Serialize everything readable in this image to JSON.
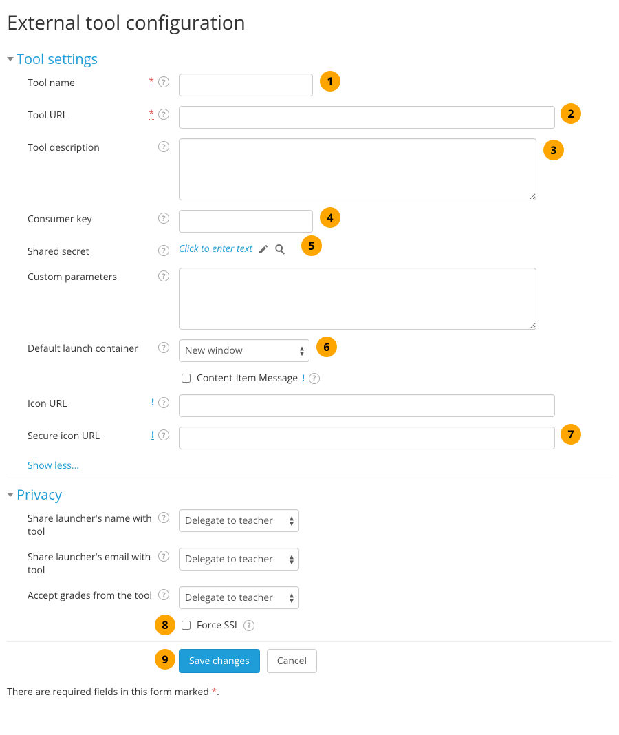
{
  "page_title": "External tool configuration",
  "sections": {
    "tool_settings": {
      "title": "Tool settings",
      "fields": {
        "tool_name": {
          "label": "Tool name",
          "value": ""
        },
        "tool_url": {
          "label": "Tool URL",
          "value": ""
        },
        "tool_description": {
          "label": "Tool description",
          "value": ""
        },
        "consumer_key": {
          "label": "Consumer key",
          "value": ""
        },
        "shared_secret": {
          "label": "Shared secret",
          "placeholder_link": "Click to enter text"
        },
        "custom_parameters": {
          "label": "Custom parameters",
          "value": ""
        },
        "default_launch_container": {
          "label": "Default launch container",
          "selected": "New window"
        },
        "content_item_message": {
          "label": "Content-Item Message",
          "checked": false
        },
        "icon_url": {
          "label": "Icon URL",
          "value": ""
        },
        "secure_icon_url": {
          "label": "Secure icon URL",
          "value": ""
        }
      },
      "show_less": "Show less..."
    },
    "privacy": {
      "title": "Privacy",
      "fields": {
        "share_name": {
          "label": "Share launcher's name with tool",
          "selected": "Delegate to teacher"
        },
        "share_email": {
          "label": "Share launcher's email with tool",
          "selected": "Delegate to teacher"
        },
        "accept_grades": {
          "label": "Accept grades from the tool",
          "selected": "Delegate to teacher"
        },
        "force_ssl": {
          "label": "Force SSL",
          "checked": false
        }
      }
    }
  },
  "actions": {
    "save": "Save changes",
    "cancel": "Cancel"
  },
  "footnote": {
    "text": "There are required fields in this form marked ",
    "asterisk": "*",
    "trailing": "."
  },
  "annotations": {
    "1": "1",
    "2": "2",
    "3": "3",
    "4": "4",
    "5": "5",
    "6": "6",
    "7": "7",
    "8": "8",
    "9": "9"
  }
}
